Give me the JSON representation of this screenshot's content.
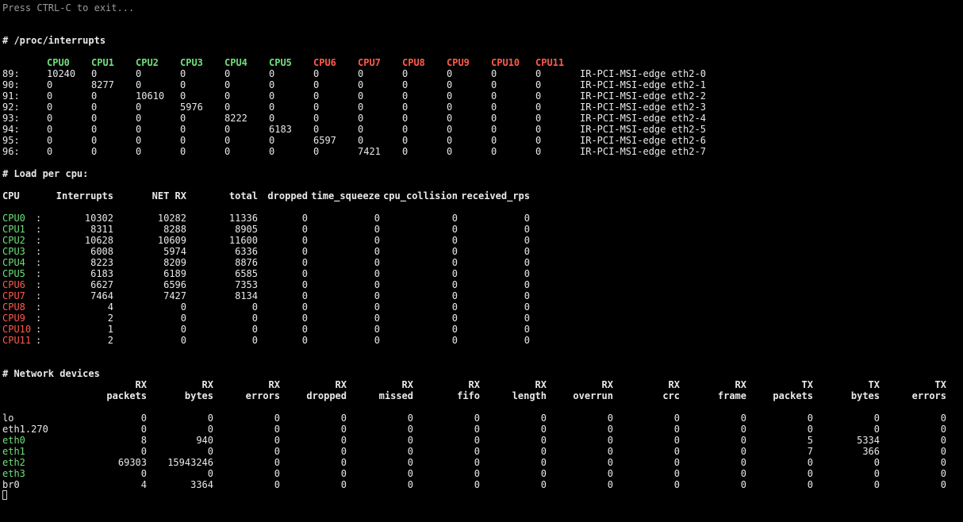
{
  "exit_hint": "Press CTRL-C to exit...",
  "colors": {
    "background": "#000000",
    "text": "#e9e9e9",
    "online_cpu": "#6ee07a",
    "offline_cpu": "#ff5b4a"
  },
  "interrupts": {
    "title": "# /proc/interrupts",
    "cpus": [
      {
        "label": "CPU0",
        "status": "green"
      },
      {
        "label": "CPU1",
        "status": "green"
      },
      {
        "label": "CPU2",
        "status": "green"
      },
      {
        "label": "CPU3",
        "status": "green"
      },
      {
        "label": "CPU4",
        "status": "green"
      },
      {
        "label": "CPU5",
        "status": "green"
      },
      {
        "label": "CPU6",
        "status": "red"
      },
      {
        "label": "CPU7",
        "status": "red"
      },
      {
        "label": "CPU8",
        "status": "red"
      },
      {
        "label": "CPU9",
        "status": "red"
      },
      {
        "label": "CPU10",
        "status": "red"
      },
      {
        "label": "CPU11",
        "status": "red"
      }
    ],
    "rows": [
      {
        "irq": "89:",
        "counts": [
          "10240",
          "0",
          "0",
          "0",
          "0",
          "0",
          "0",
          "0",
          "0",
          "0",
          "0",
          "0"
        ],
        "desc": "IR-PCI-MSI-edge eth2-0"
      },
      {
        "irq": "90:",
        "counts": [
          "0",
          "8277",
          "0",
          "0",
          "0",
          "0",
          "0",
          "0",
          "0",
          "0",
          "0",
          "0"
        ],
        "desc": "IR-PCI-MSI-edge eth2-1"
      },
      {
        "irq": "91:",
        "counts": [
          "0",
          "0",
          "10610",
          "0",
          "0",
          "0",
          "0",
          "0",
          "0",
          "0",
          "0",
          "0"
        ],
        "desc": "IR-PCI-MSI-edge eth2-2"
      },
      {
        "irq": "92:",
        "counts": [
          "0",
          "0",
          "0",
          "5976",
          "0",
          "0",
          "0",
          "0",
          "0",
          "0",
          "0",
          "0"
        ],
        "desc": "IR-PCI-MSI-edge eth2-3"
      },
      {
        "irq": "93:",
        "counts": [
          "0",
          "0",
          "0",
          "0",
          "8222",
          "0",
          "0",
          "0",
          "0",
          "0",
          "0",
          "0"
        ],
        "desc": "IR-PCI-MSI-edge eth2-4"
      },
      {
        "irq": "94:",
        "counts": [
          "0",
          "0",
          "0",
          "0",
          "0",
          "6183",
          "0",
          "0",
          "0",
          "0",
          "0",
          "0"
        ],
        "desc": "IR-PCI-MSI-edge eth2-5"
      },
      {
        "irq": "95:",
        "counts": [
          "0",
          "0",
          "0",
          "0",
          "0",
          "0",
          "6597",
          "0",
          "0",
          "0",
          "0",
          "0"
        ],
        "desc": "IR-PCI-MSI-edge eth2-6"
      },
      {
        "irq": "96:",
        "counts": [
          "0",
          "0",
          "0",
          "0",
          "0",
          "0",
          "0",
          "7421",
          "0",
          "0",
          "0",
          "0"
        ],
        "desc": "IR-PCI-MSI-edge eth2-7"
      }
    ]
  },
  "load": {
    "title": "# Load per cpu:",
    "headers": [
      "CPU",
      "Interrupts",
      "NET RX",
      "total",
      "dropped",
      "time_squeeze",
      "cpu_collision",
      "received_rps"
    ],
    "rows": [
      {
        "cpu": "CPU0",
        "status": "green",
        "sep": ":",
        "values": [
          "10302",
          "10282",
          "11336",
          "0",
          "0",
          "0",
          "0"
        ]
      },
      {
        "cpu": "CPU1",
        "status": "green",
        "sep": ":",
        "values": [
          "8311",
          "8288",
          "8905",
          "0",
          "0",
          "0",
          "0"
        ]
      },
      {
        "cpu": "CPU2",
        "status": "green",
        "sep": ":",
        "values": [
          "10628",
          "10609",
          "11600",
          "0",
          "0",
          "0",
          "0"
        ]
      },
      {
        "cpu": "CPU3",
        "status": "green",
        "sep": ":",
        "values": [
          "6008",
          "5974",
          "6336",
          "0",
          "0",
          "0",
          "0"
        ]
      },
      {
        "cpu": "CPU4",
        "status": "green",
        "sep": ":",
        "values": [
          "8223",
          "8209",
          "8876",
          "0",
          "0",
          "0",
          "0"
        ]
      },
      {
        "cpu": "CPU5",
        "status": "green",
        "sep": ":",
        "values": [
          "6183",
          "6189",
          "6585",
          "0",
          "0",
          "0",
          "0"
        ]
      },
      {
        "cpu": "CPU6",
        "status": "red",
        "sep": ":",
        "values": [
          "6627",
          "6596",
          "7353",
          "0",
          "0",
          "0",
          "0"
        ]
      },
      {
        "cpu": "CPU7",
        "status": "red",
        "sep": ":",
        "values": [
          "7464",
          "7427",
          "8134",
          "0",
          "0",
          "0",
          "0"
        ]
      },
      {
        "cpu": "CPU8",
        "status": "red",
        "sep": ":",
        "values": [
          "4",
          "0",
          "0",
          "0",
          "0",
          "0",
          "0"
        ]
      },
      {
        "cpu": "CPU9",
        "status": "red",
        "sep": ":",
        "values": [
          "2",
          "0",
          "0",
          "0",
          "0",
          "0",
          "0"
        ]
      },
      {
        "cpu": "CPU10",
        "status": "red",
        "sep": ":",
        "values": [
          "1",
          "0",
          "0",
          "0",
          "0",
          "0",
          "0"
        ]
      },
      {
        "cpu": "CPU11",
        "status": "red",
        "sep": ":",
        "values": [
          "2",
          "0",
          "0",
          "0",
          "0",
          "0",
          "0"
        ]
      }
    ]
  },
  "netdev": {
    "title": "# Network devices",
    "headers": [
      {
        "top": "RX",
        "bottom": "packets"
      },
      {
        "top": "RX",
        "bottom": "bytes"
      },
      {
        "top": "RX",
        "bottom": "errors"
      },
      {
        "top": "RX",
        "bottom": "dropped"
      },
      {
        "top": "RX",
        "bottom": "missed"
      },
      {
        "top": "RX",
        "bottom": "fifo"
      },
      {
        "top": "RX",
        "bottom": "length"
      },
      {
        "top": "RX",
        "bottom": "overrun"
      },
      {
        "top": "RX",
        "bottom": "crc"
      },
      {
        "top": "RX",
        "bottom": "frame"
      },
      {
        "top": "TX",
        "bottom": "packets"
      },
      {
        "top": "TX",
        "bottom": "bytes"
      },
      {
        "top": "TX",
        "bottom": "errors"
      }
    ],
    "rows": [
      {
        "name": "lo",
        "status": "default",
        "values": [
          "0",
          "0",
          "0",
          "0",
          "0",
          "0",
          "0",
          "0",
          "0",
          "0",
          "0",
          "0",
          "0"
        ]
      },
      {
        "name": "eth1.270",
        "status": "default",
        "values": [
          "0",
          "0",
          "0",
          "0",
          "0",
          "0",
          "0",
          "0",
          "0",
          "0",
          "0",
          "0",
          "0"
        ]
      },
      {
        "name": "eth0",
        "status": "green",
        "values": [
          "8",
          "940",
          "0",
          "0",
          "0",
          "0",
          "0",
          "0",
          "0",
          "0",
          "5",
          "5334",
          "0"
        ]
      },
      {
        "name": "eth1",
        "status": "green",
        "values": [
          "0",
          "0",
          "0",
          "0",
          "0",
          "0",
          "0",
          "0",
          "0",
          "0",
          "7",
          "366",
          "0"
        ]
      },
      {
        "name": "eth2",
        "status": "green",
        "values": [
          "69303",
          "15943246",
          "0",
          "0",
          "0",
          "0",
          "0",
          "0",
          "0",
          "0",
          "0",
          "0",
          "0"
        ]
      },
      {
        "name": "eth3",
        "status": "green",
        "values": [
          "0",
          "0",
          "0",
          "0",
          "0",
          "0",
          "0",
          "0",
          "0",
          "0",
          "0",
          "0",
          "0"
        ]
      },
      {
        "name": "br0",
        "status": "default",
        "values": [
          "4",
          "3364",
          "0",
          "0",
          "0",
          "0",
          "0",
          "0",
          "0",
          "0",
          "0",
          "0",
          "0"
        ]
      }
    ]
  }
}
